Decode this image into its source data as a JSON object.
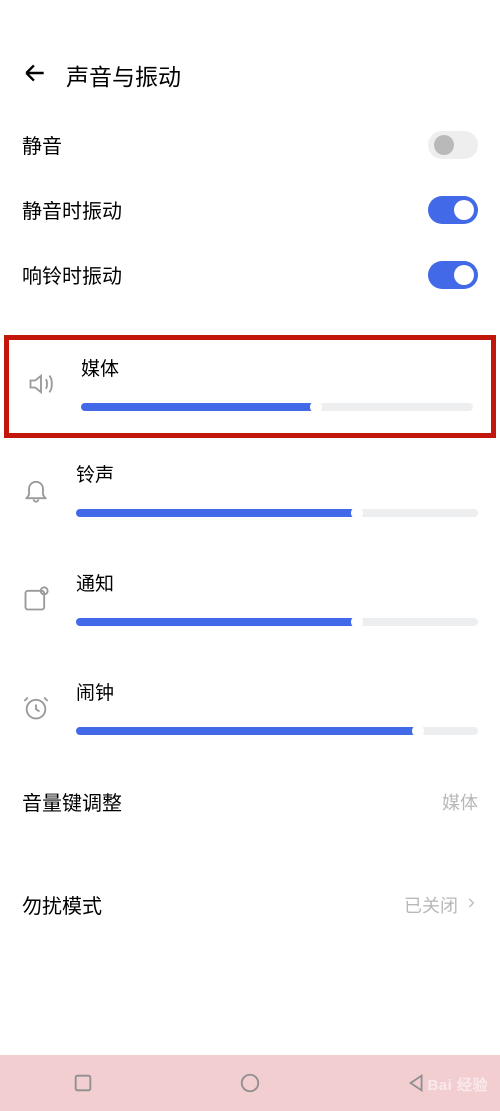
{
  "header": {
    "title": "声音与振动"
  },
  "toggles": {
    "mute": {
      "label": "静音",
      "on": false
    },
    "vibrate_on_mute": {
      "label": "静音时振动",
      "on": true
    },
    "vibrate_on_ring": {
      "label": "响铃时振动",
      "on": true
    }
  },
  "sliders": {
    "media": {
      "label": "媒体",
      "percent": 60
    },
    "ringtone": {
      "label": "铃声",
      "percent": 70
    },
    "notification": {
      "label": "通知",
      "percent": 70
    },
    "alarm": {
      "label": "闹钟",
      "percent": 85
    }
  },
  "volume_key": {
    "label": "音量键调整",
    "value": "媒体"
  },
  "dnd": {
    "label": "勿扰模式",
    "value": "已关闭"
  },
  "watermark": {
    "brand": "Bai",
    "brand2": "经验"
  },
  "colors": {
    "accent": "#4269e8",
    "highlight_border": "#c2160a"
  }
}
